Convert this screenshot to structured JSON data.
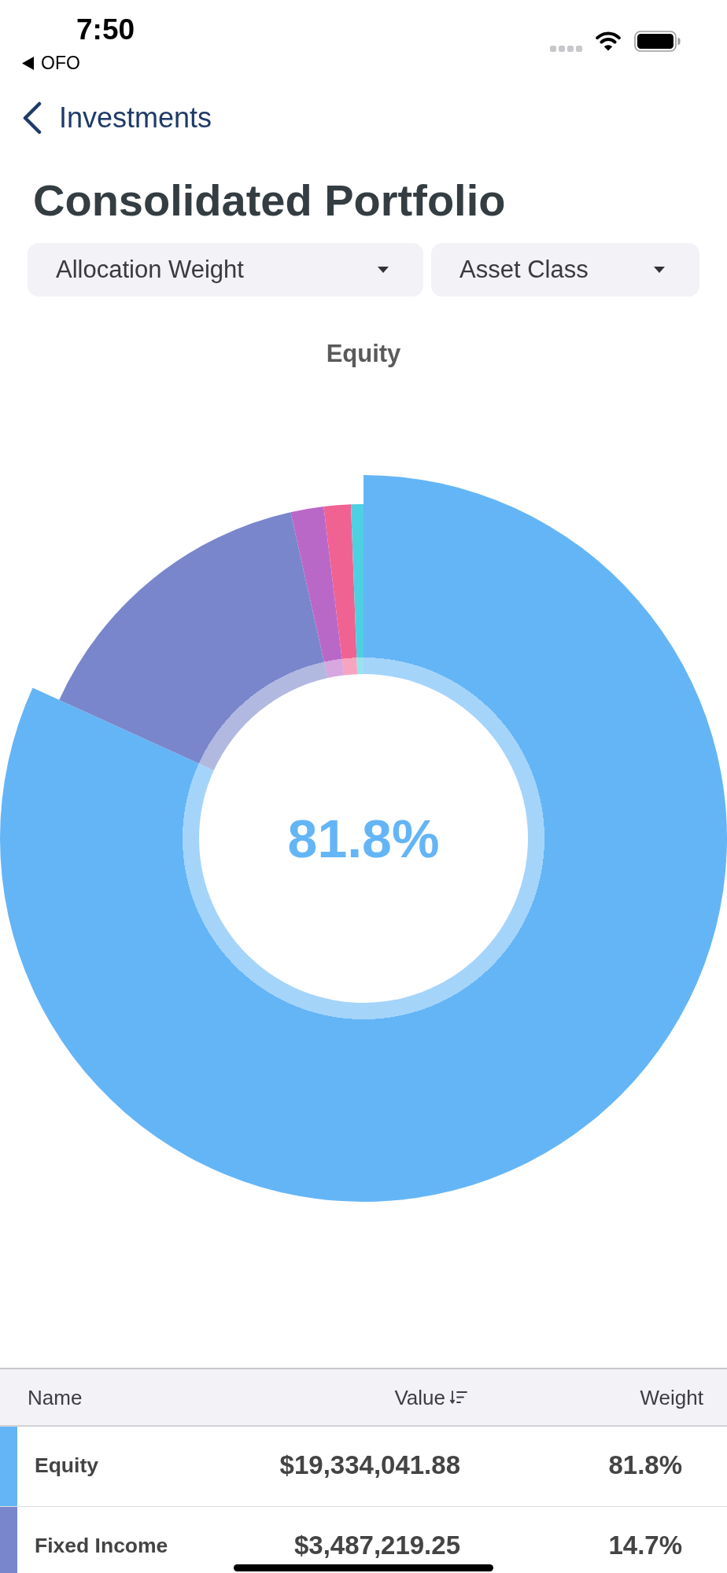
{
  "status_bar": {
    "time": "7:50",
    "back_app": "OFO"
  },
  "nav": {
    "back_label": "Investments"
  },
  "title": "Consolidated Portfolio",
  "filters": [
    {
      "label": "Allocation Weight"
    },
    {
      "label": "Asset Class"
    }
  ],
  "chart": {
    "center_label": "81.8%",
    "slices": [
      {
        "color": "#64b5f6",
        "selected": true
      },
      {
        "color": "#7986cb",
        "selected": false
      },
      {
        "color": "#ba68c8",
        "selected": false
      },
      {
        "color": "#f06292",
        "selected": false
      },
      {
        "color": "#4dd0e1",
        "selected": false
      }
    ],
    "chart_data": {
      "type": "donut",
      "title": "Equity",
      "values": [
        81.8,
        14.7,
        1.6,
        1.3,
        0.6
      ]
    }
  },
  "table": {
    "columns": [
      {
        "label": "Name",
        "sorted": false
      },
      {
        "label": "Value",
        "sorted": true
      },
      {
        "label": "Weight",
        "sorted": false
      }
    ],
    "rows": [
      {
        "name": "Equity",
        "value": "$19,334,041.88",
        "weight": "81.8%",
        "color": "#64b5f6"
      },
      {
        "name": "Fixed Income",
        "value": "$3,487,219.25",
        "weight": "14.7%",
        "color": "#7986cb"
      }
    ]
  }
}
